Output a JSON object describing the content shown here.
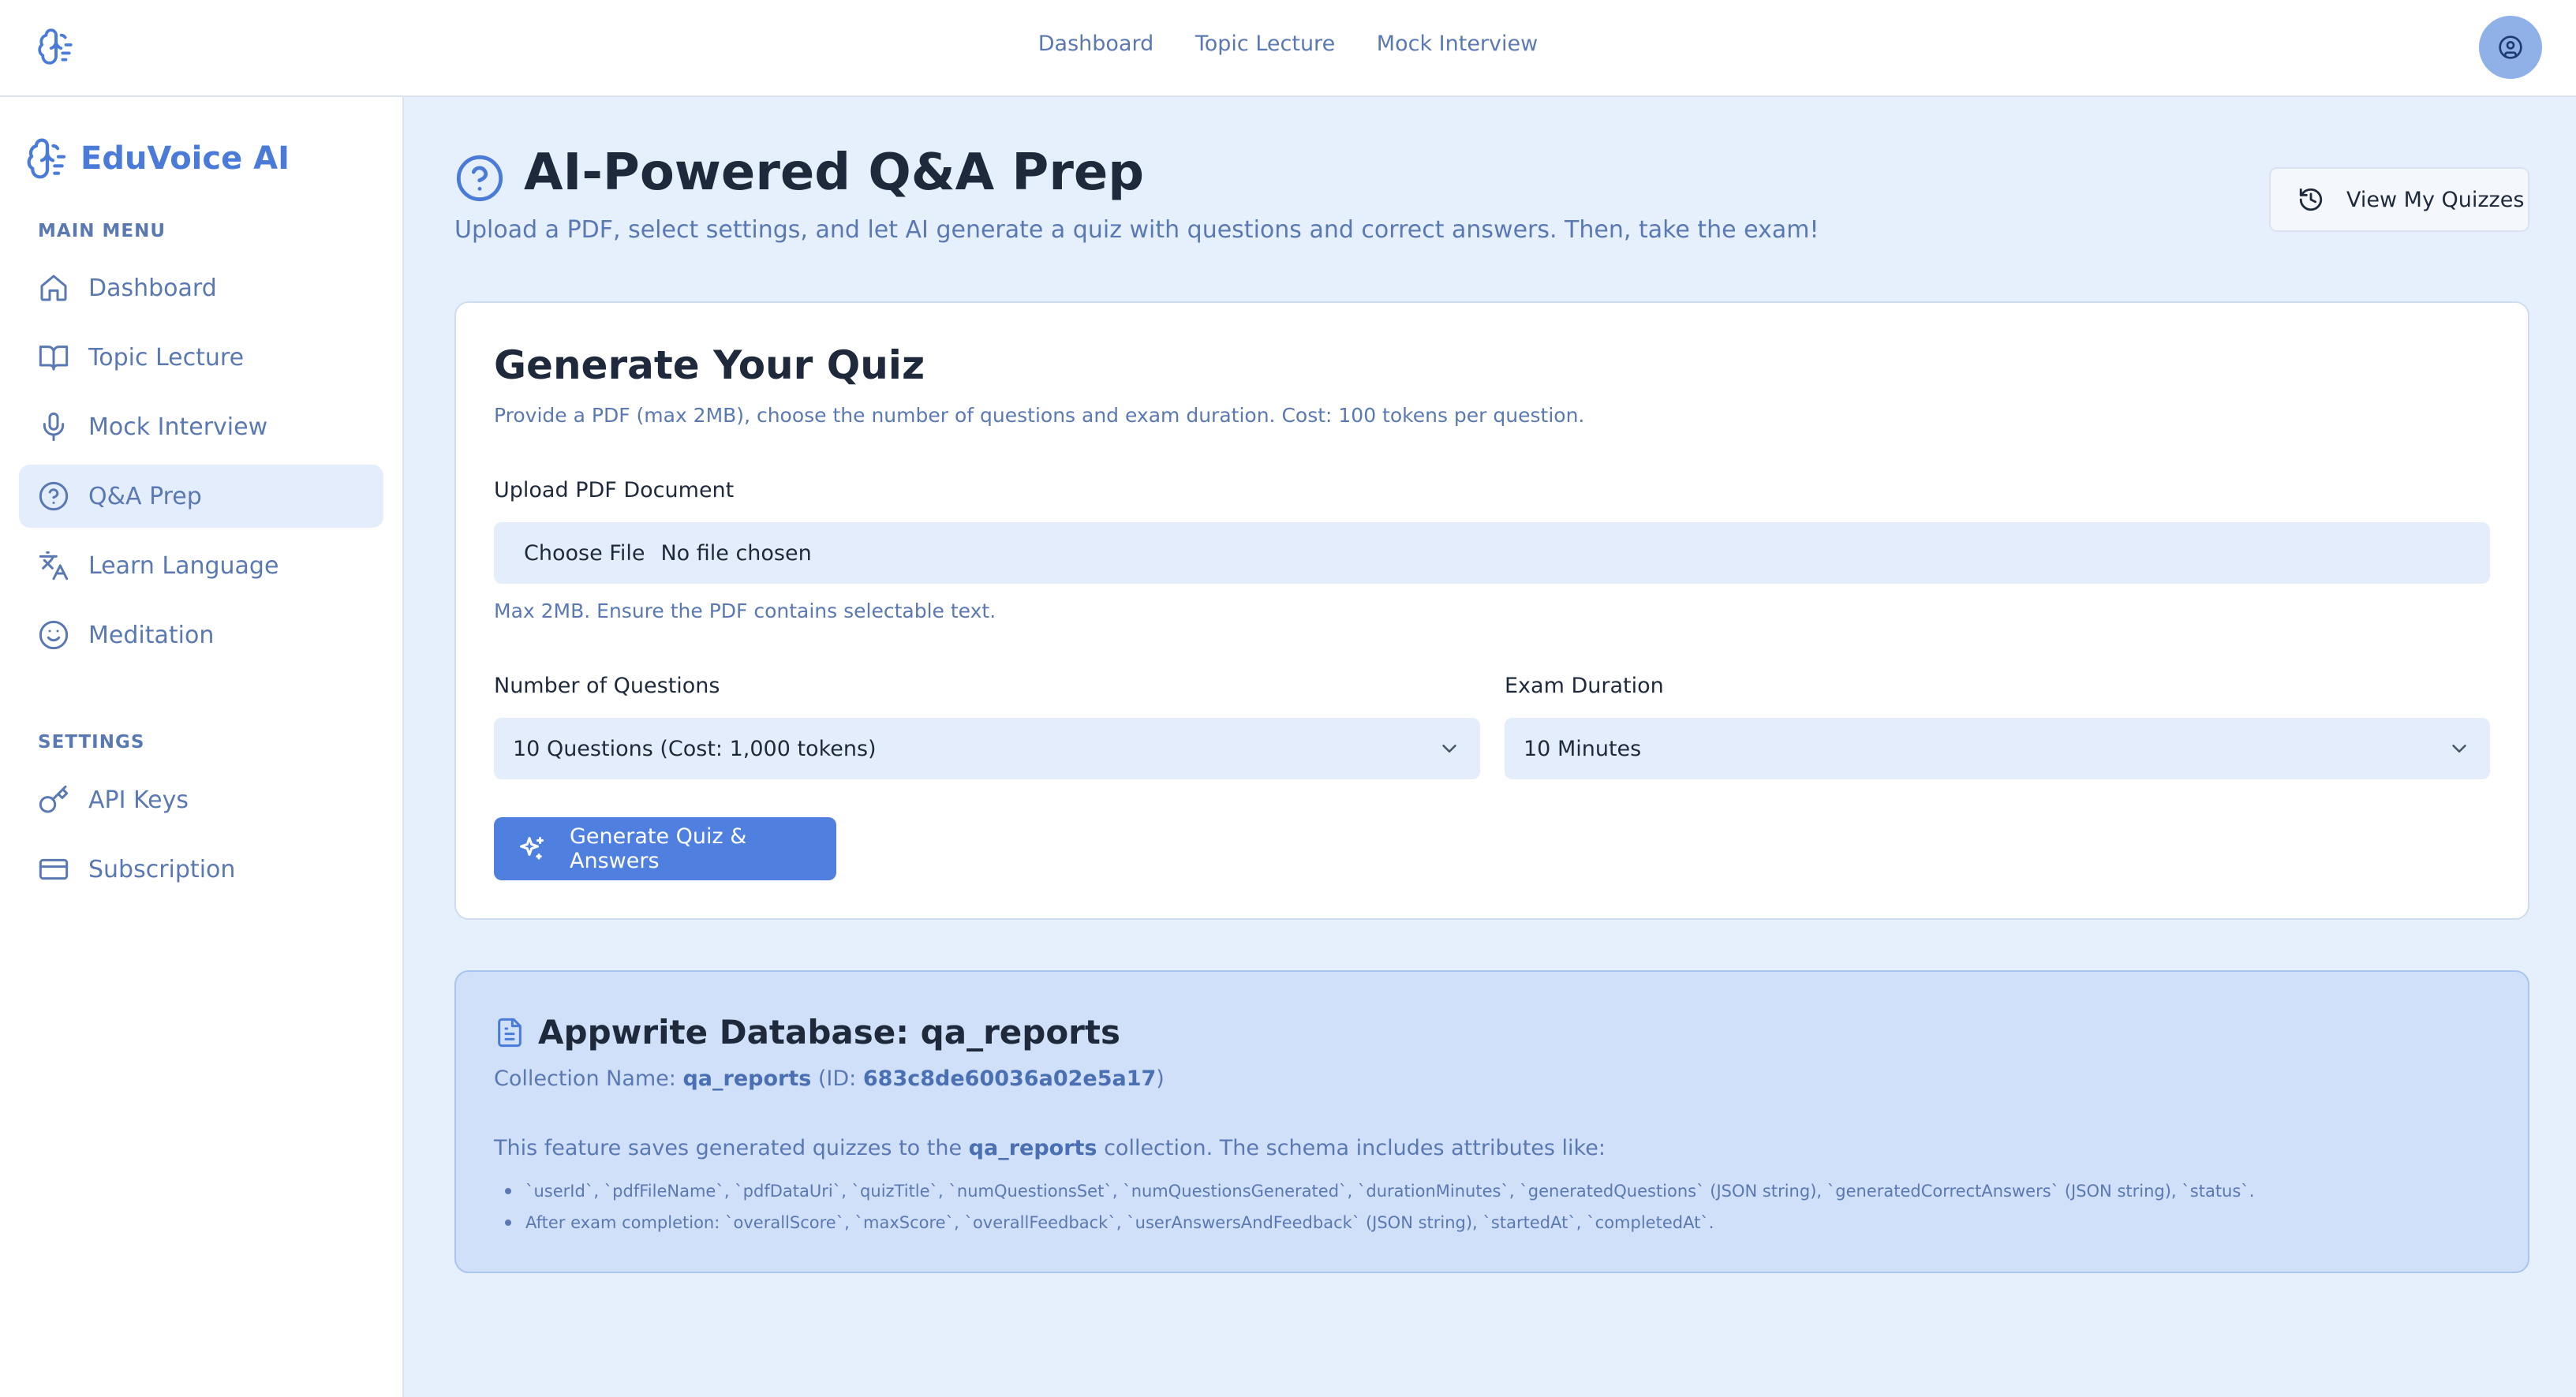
{
  "topbar": {
    "nav": [
      "Dashboard",
      "Topic Lecture",
      "Mock Interview"
    ]
  },
  "sidebar": {
    "brand": "EduVoice AI",
    "main_menu_label": "MAIN MENU",
    "main_items": [
      {
        "label": "Dashboard",
        "icon": "home-icon"
      },
      {
        "label": "Topic Lecture",
        "icon": "book-icon"
      },
      {
        "label": "Mock Interview",
        "icon": "microphone-icon"
      },
      {
        "label": "Q&A Prep",
        "icon": "help-circle-icon",
        "active": true
      },
      {
        "label": "Learn Language",
        "icon": "translate-icon"
      },
      {
        "label": "Meditation",
        "icon": "smile-icon"
      }
    ],
    "settings_label": "SETTINGS",
    "settings_items": [
      {
        "label": "API Keys",
        "icon": "key-icon"
      },
      {
        "label": "Subscription",
        "icon": "credit-card-icon"
      }
    ]
  },
  "page": {
    "title": "AI-Powered Q&A Prep",
    "subtitle": "Upload a PDF, select settings, and let AI generate a quiz with questions and correct answers. Then, take the exam!",
    "view_quizzes_label": "View My Quizzes"
  },
  "form": {
    "title": "Generate Your Quiz",
    "description": "Provide a PDF (max 2MB), choose the number of questions and exam duration. Cost: 100 tokens per question.",
    "upload_label": "Upload PDF Document",
    "choose_file_label": "Choose File",
    "no_file_text": "No file chosen",
    "upload_hint": "Max 2MB. Ensure the PDF contains selectable text.",
    "questions_label": "Number of Questions",
    "questions_value": "10 Questions (Cost: 1,000 tokens)",
    "duration_label": "Exam Duration",
    "duration_value": "10 Minutes",
    "generate_label": "Generate Quiz & Answers"
  },
  "db_info": {
    "title": "Appwrite Database: qa_reports",
    "collection_prefix": "Collection Name: ",
    "collection_name": "qa_reports",
    "id_prefix": " (ID: ",
    "collection_id": "683c8de60036a02e5a17",
    "id_suffix": ")",
    "feature_prefix": "This feature saves generated quizzes to the ",
    "feature_collection": "qa_reports",
    "feature_suffix": " collection. The schema includes attributes like:",
    "attributes": [
      "`userId`, `pdfFileName`, `pdfDataUri`, `quizTitle`, `numQuestionsSet`, `numQuestionsGenerated`, `durationMinutes`, `generatedQuestions` (JSON string), `generatedCorrectAnswers` (JSON string), `status`.",
      "After exam completion: `overallScore`, `maxScore`, `overallFeedback`, `userAnswersAndFeedback` (JSON string), `startedAt`, `completedAt`."
    ]
  },
  "colors": {
    "accent": "#4a7bd8",
    "button": "#4f80e0",
    "muted_text": "#5a79b3",
    "background": "#e6f0fc"
  }
}
